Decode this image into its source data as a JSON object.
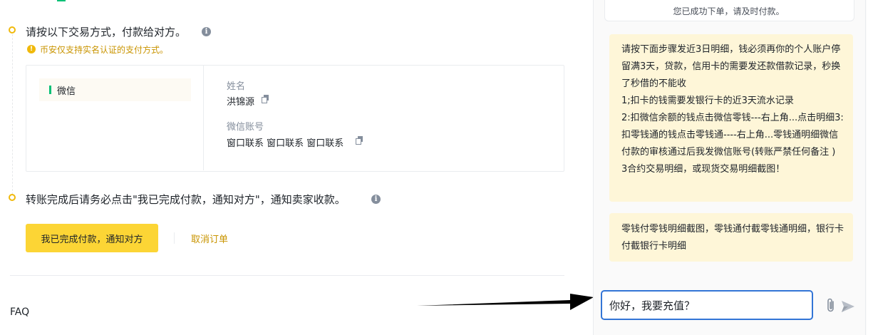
{
  "steps": {
    "step1": {
      "text": "请按以下交易方式，付款给对方。",
      "warning": "币安仅支持实名认证的支付方式。"
    },
    "payment": {
      "method_label": "微信",
      "name_label": "姓名",
      "name_value": "洪锦源",
      "account_label": "微信账号",
      "account_value": "窗口联系 窗口联系 窗口联系"
    },
    "step2": {
      "text": "转账完成后请务必点击\"我已完成付款，通知对方\"，通知卖家收款。"
    }
  },
  "actions": {
    "confirm_label": "我已完成付款，通知对方",
    "cancel_label": "取消订单"
  },
  "faq": {
    "label": "FAQ"
  },
  "chat": {
    "system_message": "您已成功下单，请及时付款。",
    "messages": [
      "请按下面步骤发近3日明细，钱必须再你的个人账户停留满3天，贷款，信用卡的需要发还款借款记录，秒换了秒借的不能收\n1;扣卡的钱需要发银行卡的近3天流水记录\n2:扣微信余额的钱点击微信零钱---右上角...点击明细3:扣零钱通的钱点击零钱通----右上角...零钱通明细微信付款的审核通过后我发微信账号(转账严禁任何备注 )\n3合约交易明细，或现货交易明细截图！",
      "零钱付零钱明细截图，零钱通付截零钱通明细，银行卡付截银行卡明细"
    ],
    "input_value": "你好，我要充值？"
  },
  "icons": {
    "info": "info-icon",
    "warning": "warning-icon",
    "copy": "copy-icon",
    "attach": "paperclip-icon",
    "send": "send-icon",
    "annotation": "arrow-annotation"
  },
  "colors": {
    "accent": "#fcd535",
    "warning_text": "#c99400",
    "method_indicator": "#02c076",
    "input_focus": "#3375d6",
    "bubble": "#fef6d8"
  }
}
